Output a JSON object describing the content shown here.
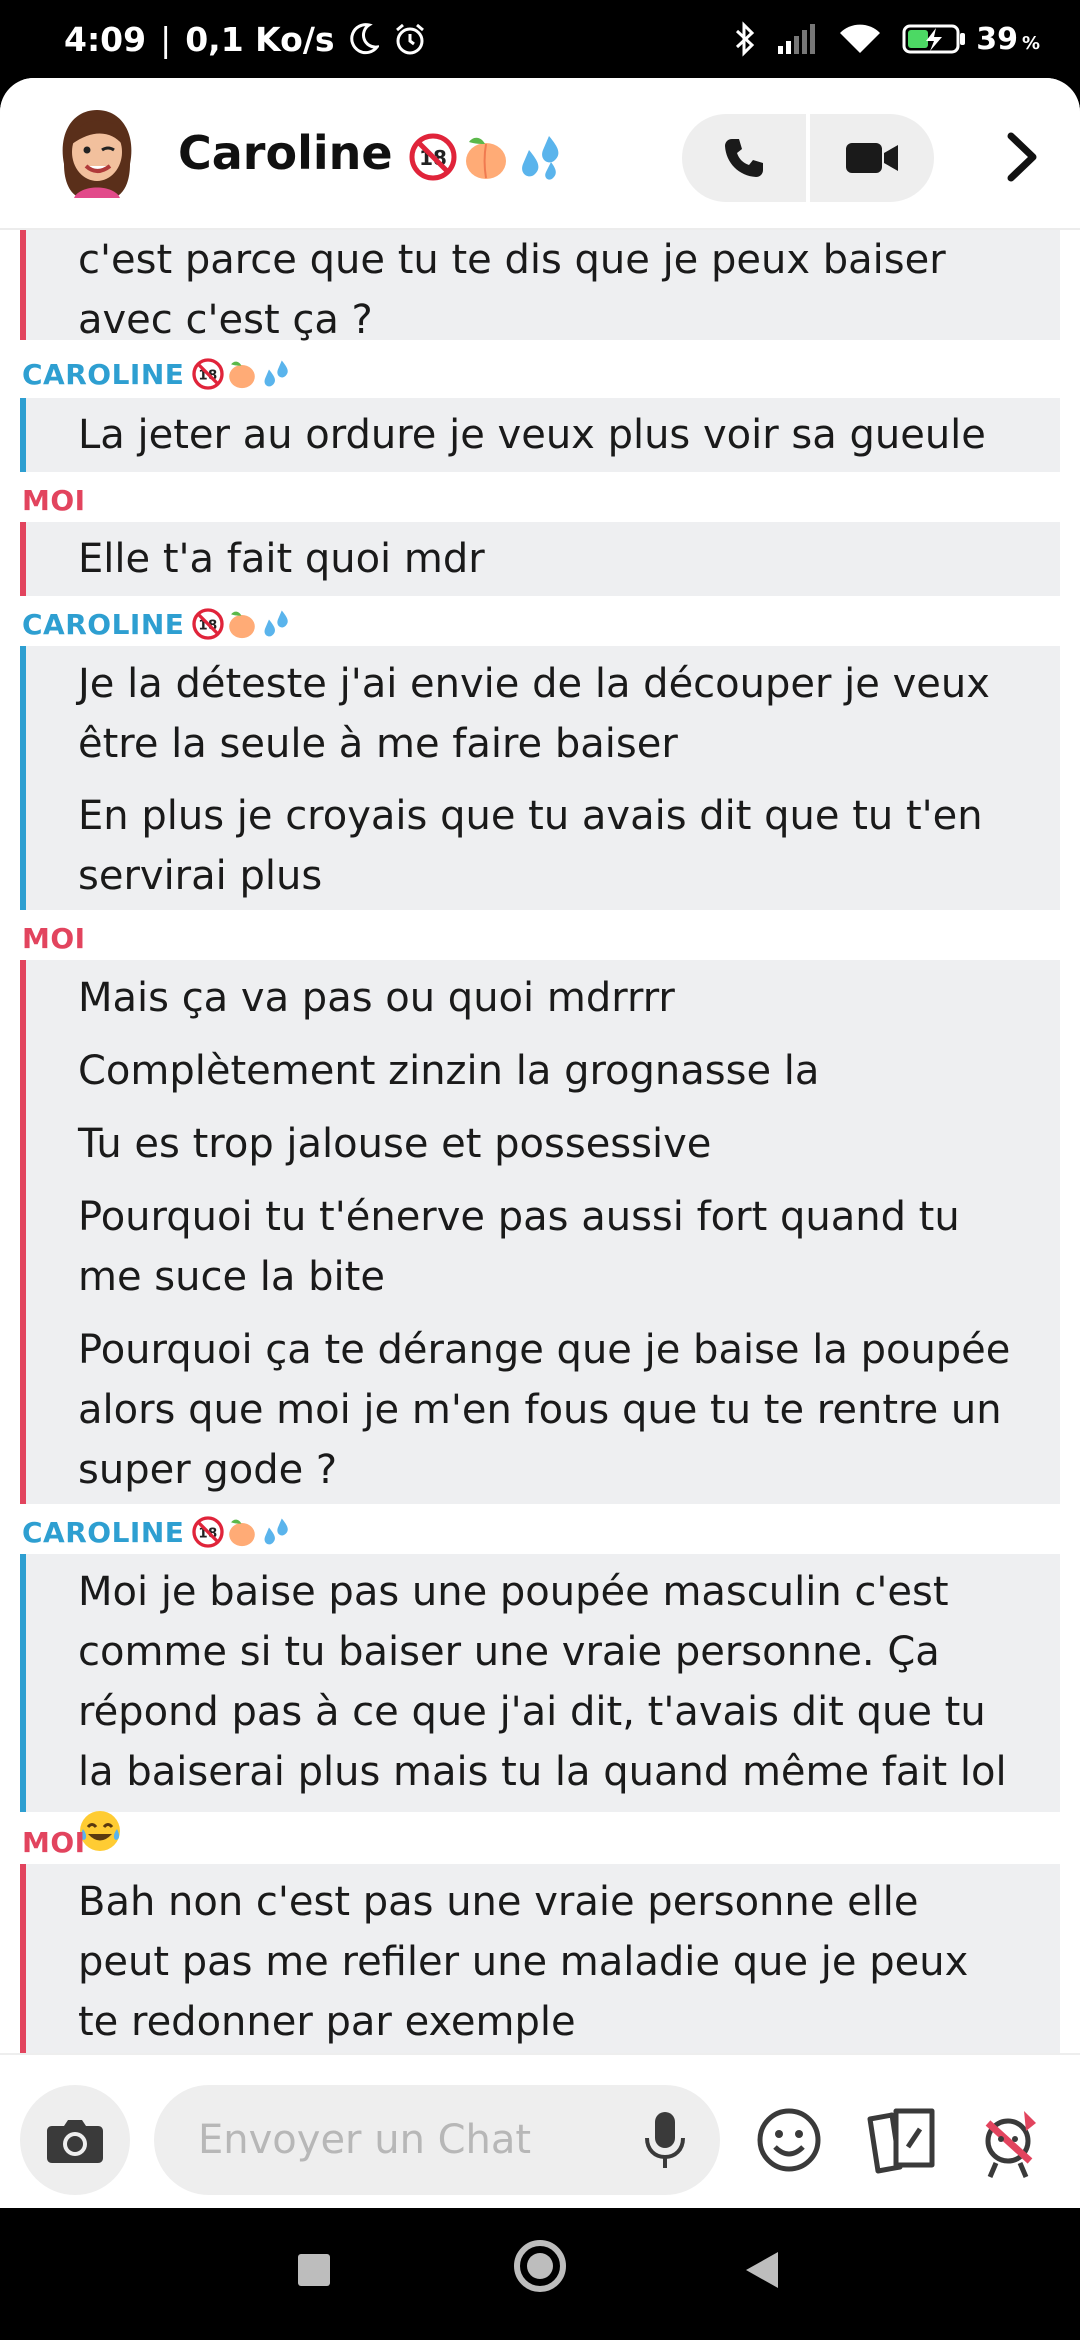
{
  "status_bar": {
    "time": "4:09",
    "net_speed": "0,1 Ko/s",
    "battery": "39",
    "battery_unit": "%"
  },
  "header": {
    "contact_name": "Caroline"
  },
  "senders": {
    "me": "MOI",
    "them": "CAROLINE"
  },
  "messages": [
    {
      "sender": "me",
      "text": "c'est parce que tu te dis que je peux baiser avec c'est ça ?"
    },
    {
      "sender": "them",
      "text": "La jeter au ordure je veux plus voir sa gueule"
    },
    {
      "sender": "me",
      "text": "Elle t'a fait quoi mdr"
    },
    {
      "sender": "them",
      "text": "Je la déteste j'ai envie de la découper je veux être la seule à me faire baiser"
    },
    {
      "sender": "them",
      "text": "En plus je croyais que tu avais dit que tu t'en servirai plus"
    },
    {
      "sender": "me",
      "text": "Mais ça va pas ou quoi mdrrrr"
    },
    {
      "sender": "me",
      "text": "Complètement zinzin la grognasse la"
    },
    {
      "sender": "me",
      "text": "Tu es trop jalouse et possessive"
    },
    {
      "sender": "me",
      "text": "Pourquoi tu t'énerve pas aussi fort quand tu me suce la bite"
    },
    {
      "sender": "me",
      "text": "Pourquoi ça te dérange que je baise la poupée alors que moi je m'en fous que tu te rentre un super gode ?"
    },
    {
      "sender": "them",
      "text": "Moi je baise pas une poupée masculin c'est comme si tu baiser une vraie personne. Ça répond pas à ce que j'ai dit, t'avais dit que tu la baiserai plus mais tu la quand même fait lol"
    },
    {
      "sender": "me",
      "text": "Bah non c'est pas une vraie personne elle peut pas me refiler une maladie que je peux te redonner par exemple"
    }
  ],
  "input": {
    "placeholder": "Envoyer un Chat"
  },
  "icons": {
    "name_badges": [
      "18-plus-icon",
      "peach-icon",
      "droplets-icon"
    ],
    "header_actions": [
      "phone-icon",
      "video-icon",
      "chevron-right-icon"
    ],
    "input_actions": [
      "camera-icon",
      "mic-icon",
      "smiley-icon",
      "cards-icon",
      "bitmoji-icon"
    ],
    "laugh_emoji": "tears-of-joy-icon"
  },
  "colors": {
    "me": "#e2445e",
    "them": "#2e9fd1",
    "bubble_bg": "#eeeff1"
  }
}
